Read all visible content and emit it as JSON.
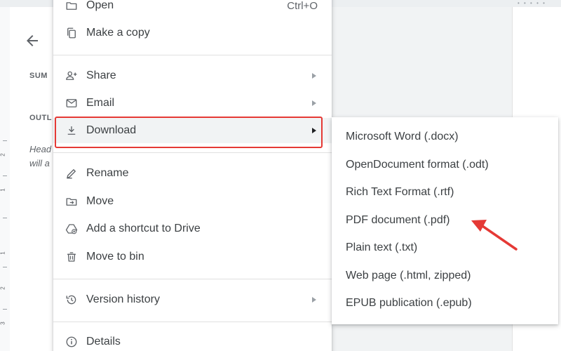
{
  "file_menu": {
    "items": [
      {
        "label": "Open",
        "shortcut": "Ctrl+O",
        "icon": "folder-icon"
      },
      {
        "label": "Make a copy",
        "icon": "copy-icon"
      },
      {
        "label": "Share",
        "icon": "person-add-icon",
        "submenu": true
      },
      {
        "label": "Email",
        "icon": "mail-icon",
        "submenu": true
      },
      {
        "label": "Download",
        "icon": "download-icon",
        "submenu": true,
        "active": true
      },
      {
        "label": "Rename",
        "icon": "pencil-icon"
      },
      {
        "label": "Move",
        "icon": "move-folder-icon"
      },
      {
        "label": "Add a shortcut to Drive",
        "icon": "drive-shortcut-icon"
      },
      {
        "label": "Move to bin",
        "icon": "trash-icon"
      },
      {
        "label": "Version history",
        "icon": "history-icon",
        "submenu": true
      },
      {
        "label": "Details",
        "icon": "info-icon"
      }
    ]
  },
  "download_submenu": {
    "items": [
      "Microsoft Word (.docx)",
      "OpenDocument format (.odt)",
      "Rich Text Format (.rtf)",
      "PDF document (.pdf)",
      "Plain text (.txt)",
      "Web page (.html, zipped)",
      "EPUB publication (.epub)"
    ]
  },
  "outline_panel": {
    "summary_label": "SUM",
    "outline_label": "OUTL",
    "hint_line1": "Head",
    "hint_line2": "will a"
  },
  "ruler": {
    "numbers": [
      "2",
      "1",
      "1",
      "2",
      "3"
    ]
  },
  "colors": {
    "highlight_box": "#e53935",
    "annotation_arrow": "#e53935",
    "active_row_bg": "#f1f3f4"
  }
}
